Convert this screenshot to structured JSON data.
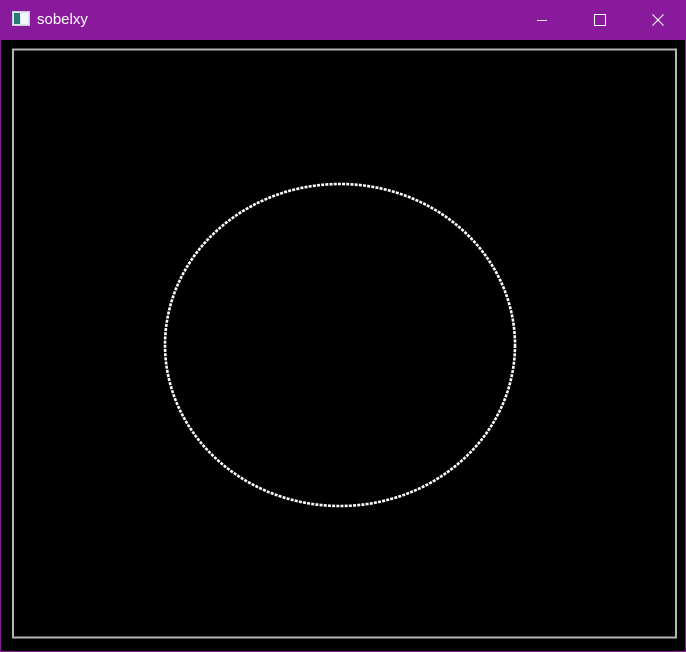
{
  "window": {
    "title": "sobelxy",
    "accent_color": "#8a1a9c",
    "controls": {
      "minimize_icon": "minimize-icon",
      "maximize_icon": "maximize-icon",
      "close_icon": "close-icon"
    }
  },
  "image": {
    "background_color": "#000000",
    "edge_color": "#ffffff",
    "border_color": "#b4b4b4"
  }
}
